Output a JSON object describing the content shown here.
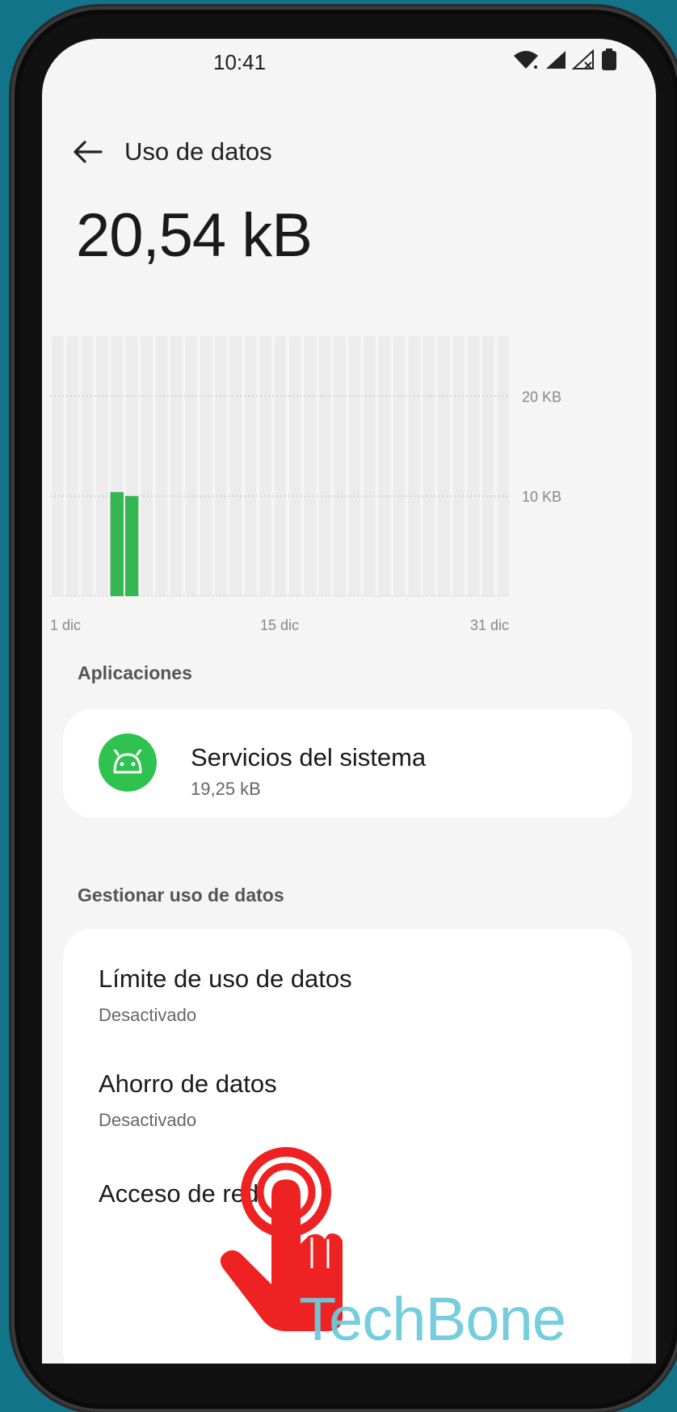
{
  "status_bar": {
    "time": "10:41",
    "icons": [
      "wifi-icon",
      "signal-icon",
      "signal-no-sim-icon",
      "battery-icon"
    ]
  },
  "header": {
    "back_icon": "arrow-left-icon",
    "title": "Uso de datos"
  },
  "total_usage": "20,54 kB",
  "chart_data": {
    "type": "bar",
    "x_tick_labels": [
      "1 dic",
      "15 dic",
      "31 dic"
    ],
    "y_tick_labels": [
      "20 KB",
      "10 KB"
    ],
    "ylim": [
      0,
      26
    ],
    "bar_color": "#34b753",
    "days": 31,
    "bars": [
      {
        "day": 5,
        "value": 10.4
      },
      {
        "day": 6,
        "value": 10.0
      }
    ],
    "grid": true
  },
  "apps_section": {
    "label": "Aplicaciones",
    "items": [
      {
        "name": "Servicios del sistema",
        "size": "19,25 kB",
        "icon": "android-icon",
        "icon_color": "#2fc24f"
      }
    ]
  },
  "manage_section": {
    "label": "Gestionar uso de datos",
    "items": [
      {
        "title": "Límite de uso de datos",
        "subtitle": "Desactivado"
      },
      {
        "title": "Ahorro de datos",
        "subtitle": "Desactivado"
      },
      {
        "title": "Acceso de red"
      }
    ]
  },
  "overlay": {
    "tap_icon": "tap-hand-icon",
    "tap_color": "#ee2222",
    "watermark": "TechBone"
  }
}
